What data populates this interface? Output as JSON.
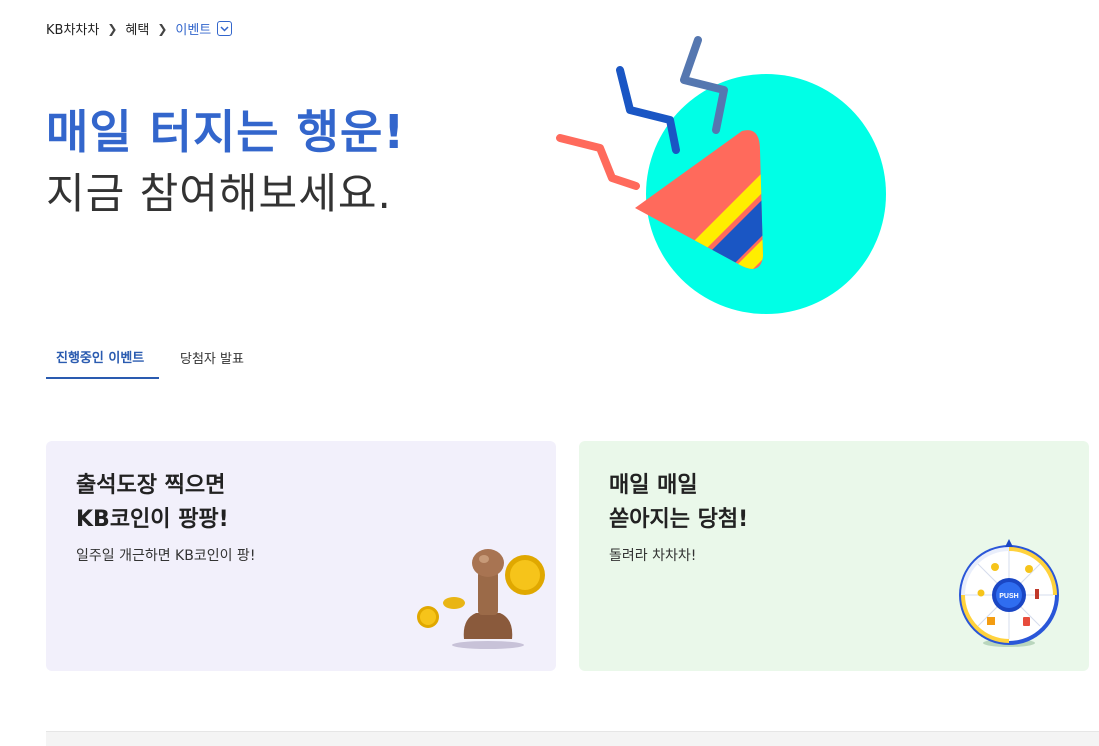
{
  "breadcrumb": {
    "home": "KB차차차",
    "level1": "혜택",
    "current": "이벤트"
  },
  "hero": {
    "title": "매일 터지는 행운!",
    "subtitle": "지금 참여해보세요."
  },
  "tabs": [
    {
      "label": "진행중인 이벤트",
      "active": true
    },
    {
      "label": "당첨자 발표",
      "active": false
    }
  ],
  "cards": [
    {
      "title_line1": "출석도장 찍으면",
      "title_line2": "KB코인이 팡팡!",
      "description": "일주일 개근하면 KB코인이 팡!",
      "illustration": "stamp-and-coins"
    },
    {
      "title_line1": "매일 매일",
      "title_line2": "쏟아지는 당첨!",
      "description": "돌려라 차차차!",
      "illustration": "roulette-wheel",
      "wheel_center_label": "PUSH"
    }
  ],
  "colors": {
    "accent": "#3366cc",
    "card1_bg": "#f2f0fb",
    "card2_bg": "#eaf8ea",
    "party_circle": "#00ffe6",
    "party_cone": "#ff6a5c"
  }
}
